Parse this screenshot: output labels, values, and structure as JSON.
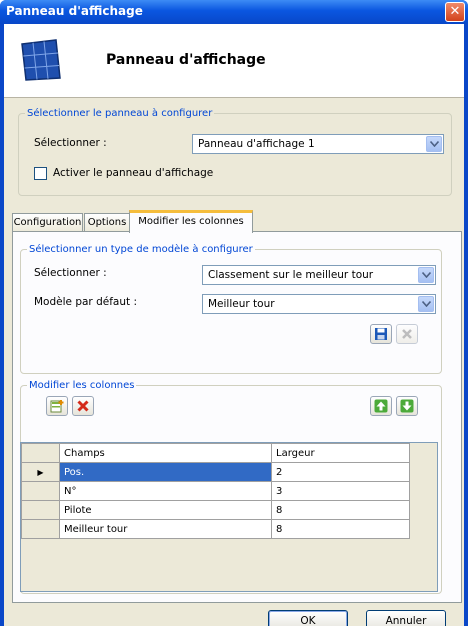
{
  "window": {
    "title": "Panneau d'affichage",
    "close_glyph": "✕",
    "header_title": "Panneau d'affichage",
    "logo_icon": "solar-panel-icon"
  },
  "select_panel": {
    "legend": "Sélectionner le panneau à configurer",
    "label": "Sélectionner :",
    "value": "Panneau d'affichage 1",
    "activate_label": "Activer le panneau d'affichage",
    "activate_checked": false
  },
  "tabs": [
    {
      "label": "Configuration",
      "active": false
    },
    {
      "label": "Options",
      "active": false
    },
    {
      "label": "Modifier les colonnes",
      "active": true
    }
  ],
  "template_group": {
    "legend": "Sélectionner un type de modèle à configurer",
    "select_label": "Sélectionner :",
    "select_value": "Classement sur le meilleur tour",
    "default_label": "Modèle par défaut :",
    "default_value": "Meilleur tour",
    "icons": [
      "save-icon",
      "delete-icon"
    ]
  },
  "columns_group": {
    "legend": "Modifier les colonnes",
    "icons": [
      "add-icon",
      "delete-icon",
      "move-up-icon",
      "move-down-icon"
    ],
    "headers": [
      "Champs",
      "Largeur"
    ],
    "rows": [
      {
        "field": "Pos.",
        "width": "2",
        "selected": true
      },
      {
        "field": "N°",
        "width": "3",
        "selected": false
      },
      {
        "field": "Pilote",
        "width": "8",
        "selected": false
      },
      {
        "field": "Meilleur tour",
        "width": "8",
        "selected": false
      }
    ],
    "row_indicator": "▶"
  },
  "buttons": {
    "ok": "OK",
    "cancel": "Annuler"
  },
  "colors": {
    "titlebar": "#0a56e0",
    "accent_text": "#0046d5",
    "selection": "#316ac5",
    "tab_highlight": "#f5bd3c"
  }
}
